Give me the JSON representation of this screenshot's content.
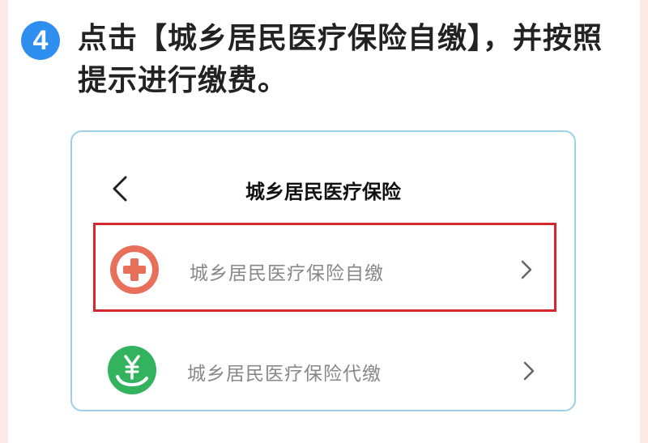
{
  "step": {
    "number": "4",
    "text": "点击【城乡居民医疗保险自缴】，并按照提示进行缴费。"
  },
  "screen": {
    "title": "城乡居民医疗保险"
  },
  "menu": {
    "items": [
      {
        "label": "城乡居民医疗保险自缴",
        "icon": "medical-cross-icon",
        "color": "#e8705a",
        "highlight": "#d5282e"
      },
      {
        "label": "城乡居民医疗保险代缴",
        "icon": "yuan-hand-icon",
        "color": "#34b35f"
      }
    ]
  }
}
